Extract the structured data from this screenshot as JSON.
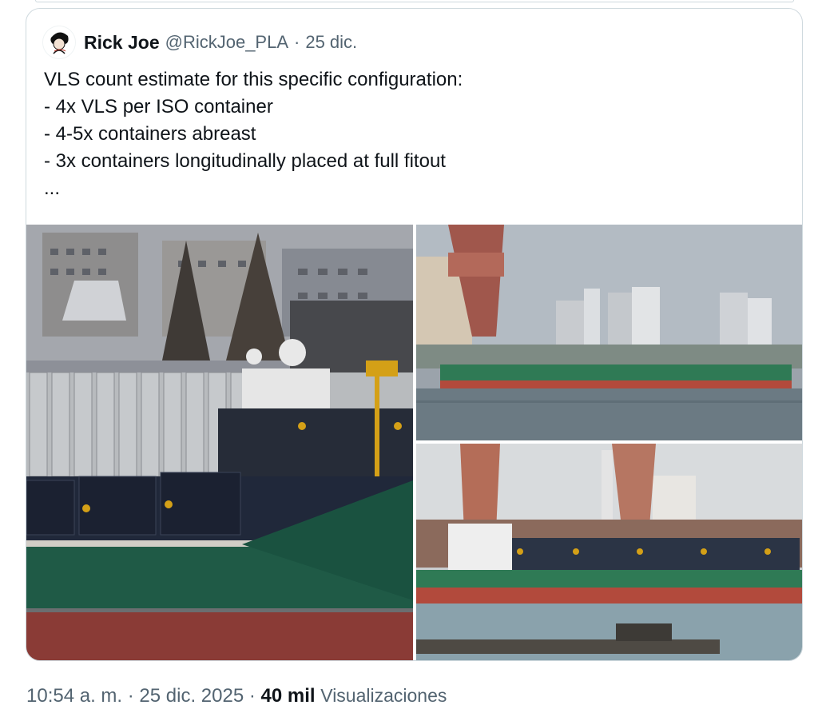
{
  "tweet": {
    "author_name": "Rick Joe",
    "author_handle": "@RickJoe_PLA",
    "separator": "·",
    "date": "25 dic.",
    "lines": [
      "VLS count estimate for this specific configuration:",
      "- 4x VLS per ISO container",
      "- 4-5x containers abreast",
      "- 3x containers longitudinally placed at full fitout",
      "..."
    ],
    "images": [
      {
        "icon": "ship-closeup-photo"
      },
      {
        "icon": "ship-harbor-photo"
      },
      {
        "icon": "ship-dock-photo"
      }
    ]
  },
  "footer": {
    "time": "10:54 a. m.",
    "sep1": "·",
    "date": "25 dic. 2025",
    "sep2": "·",
    "views_count": "40 mil",
    "views_label": "Visualizaciones"
  },
  "colors": {
    "hull_green": "#1f5a46",
    "hull_red": "#8a3b36",
    "text": "#0f1419",
    "muted": "#536471",
    "border": "#cfd9de"
  }
}
